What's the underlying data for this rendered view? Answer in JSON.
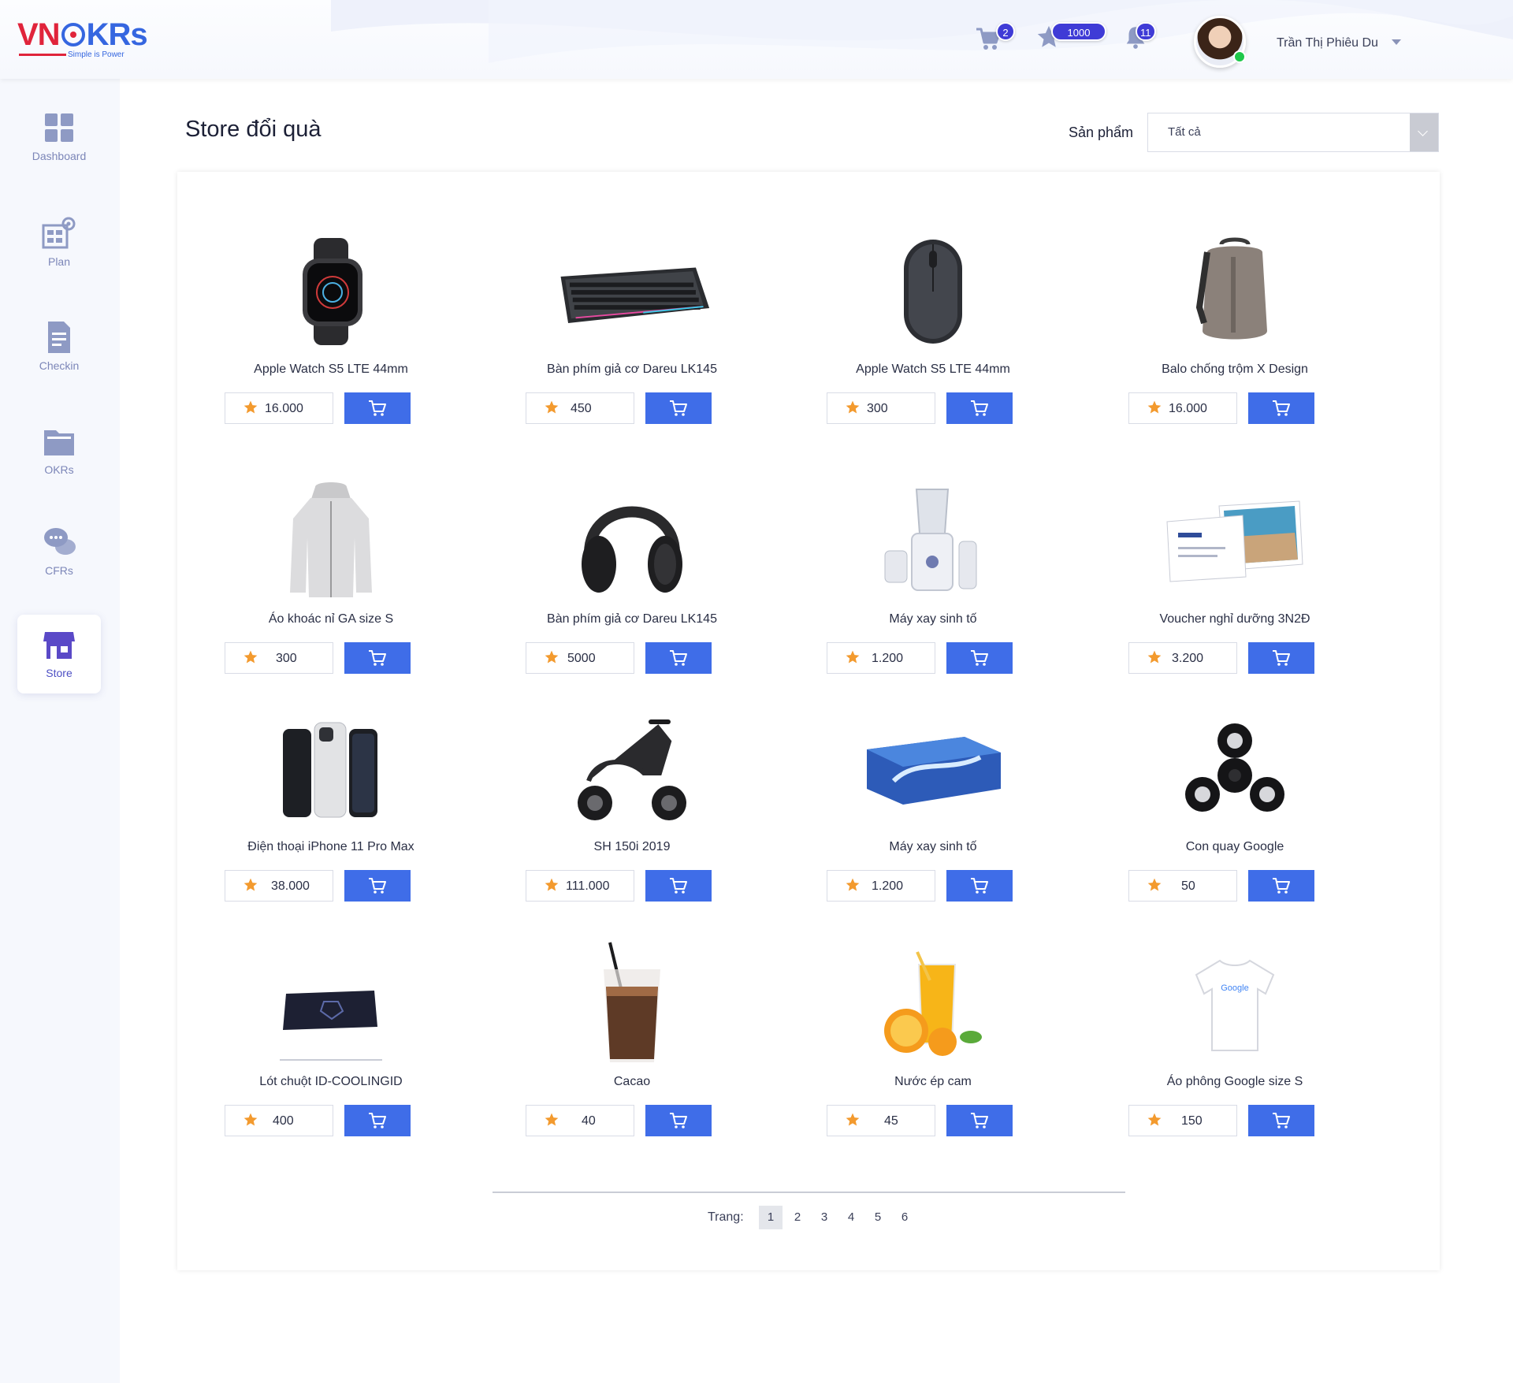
{
  "brand": {
    "logo_vn": "VN",
    "logo_krs": "KRs",
    "tagline": "Simple is Power"
  },
  "header": {
    "cart_badge": "2",
    "star_badge": "1000",
    "bell_badge": "11",
    "username": "Trần Thị Phiêu Du"
  },
  "sidebar": {
    "items": [
      {
        "label": "Dashboard",
        "icon": "dashboard-icon"
      },
      {
        "label": "Plan",
        "icon": "plan-icon"
      },
      {
        "label": "Checkin",
        "icon": "checkin-icon"
      },
      {
        "label": "OKRs",
        "icon": "okrs-icon"
      },
      {
        "label": "CFRs",
        "icon": "cfrs-icon"
      },
      {
        "label": "Store",
        "icon": "store-icon",
        "active": true
      }
    ]
  },
  "main": {
    "title": "Store đổi quà",
    "filter_label": "Sản phẩm",
    "filter_value": "Tất cả"
  },
  "products": [
    {
      "name": "Apple Watch S5 LTE 44mm",
      "price": "16.000",
      "icon": "watch-icon"
    },
    {
      "name": "Bàn phím giả cơ Dareu LK145",
      "price": "450",
      "icon": "keyboard-icon"
    },
    {
      "name": "Apple Watch S5 LTE 44mm",
      "price": "300",
      "icon": "mouse-icon"
    },
    {
      "name": "Balo chống trộm X Design",
      "price": "16.000",
      "icon": "backpack-icon"
    },
    {
      "name": "Áo khoác nỉ GA size S",
      "price": "300",
      "icon": "jacket-icon"
    },
    {
      "name": "Bàn phím giả cơ Dareu LK145",
      "price": "5000",
      "icon": "headphones-icon"
    },
    {
      "name": "Máy xay sinh tố",
      "price": "1.200",
      "icon": "blender-icon"
    },
    {
      "name": "Voucher nghỉ dưỡng 3N2Đ",
      "price": "3.200",
      "icon": "voucher-icon"
    },
    {
      "name": "Điện thoại iPhone 11 Pro Max",
      "price": "38.000",
      "icon": "phone-icon"
    },
    {
      "name": "SH 150i 2019",
      "price": "111.000",
      "icon": "scooter-icon"
    },
    {
      "name": "Máy xay sinh tố",
      "price": "1.200",
      "icon": "tissue-box-icon"
    },
    {
      "name": "Con quay Google",
      "price": "50",
      "icon": "fidget-spinner-icon"
    },
    {
      "name": "Lót chuột ID-COOLINGID",
      "price": "400",
      "icon": "mousepad-icon"
    },
    {
      "name": "Cacao",
      "price": "40",
      "icon": "cacao-drink-icon"
    },
    {
      "name": "Nước ép cam",
      "price": "45",
      "icon": "orange-juice-icon"
    },
    {
      "name": "Áo phông Google size S",
      "price": "150",
      "icon": "tshirt-icon"
    }
  ],
  "pagination": {
    "label": "Trang:",
    "pages": [
      "1",
      "2",
      "3",
      "4",
      "5",
      "6"
    ],
    "current": "1"
  },
  "colors": {
    "accent": "#3f6de8",
    "star": "#f39a2e",
    "badge": "#3f3bd6",
    "online": "#1ec84a"
  }
}
